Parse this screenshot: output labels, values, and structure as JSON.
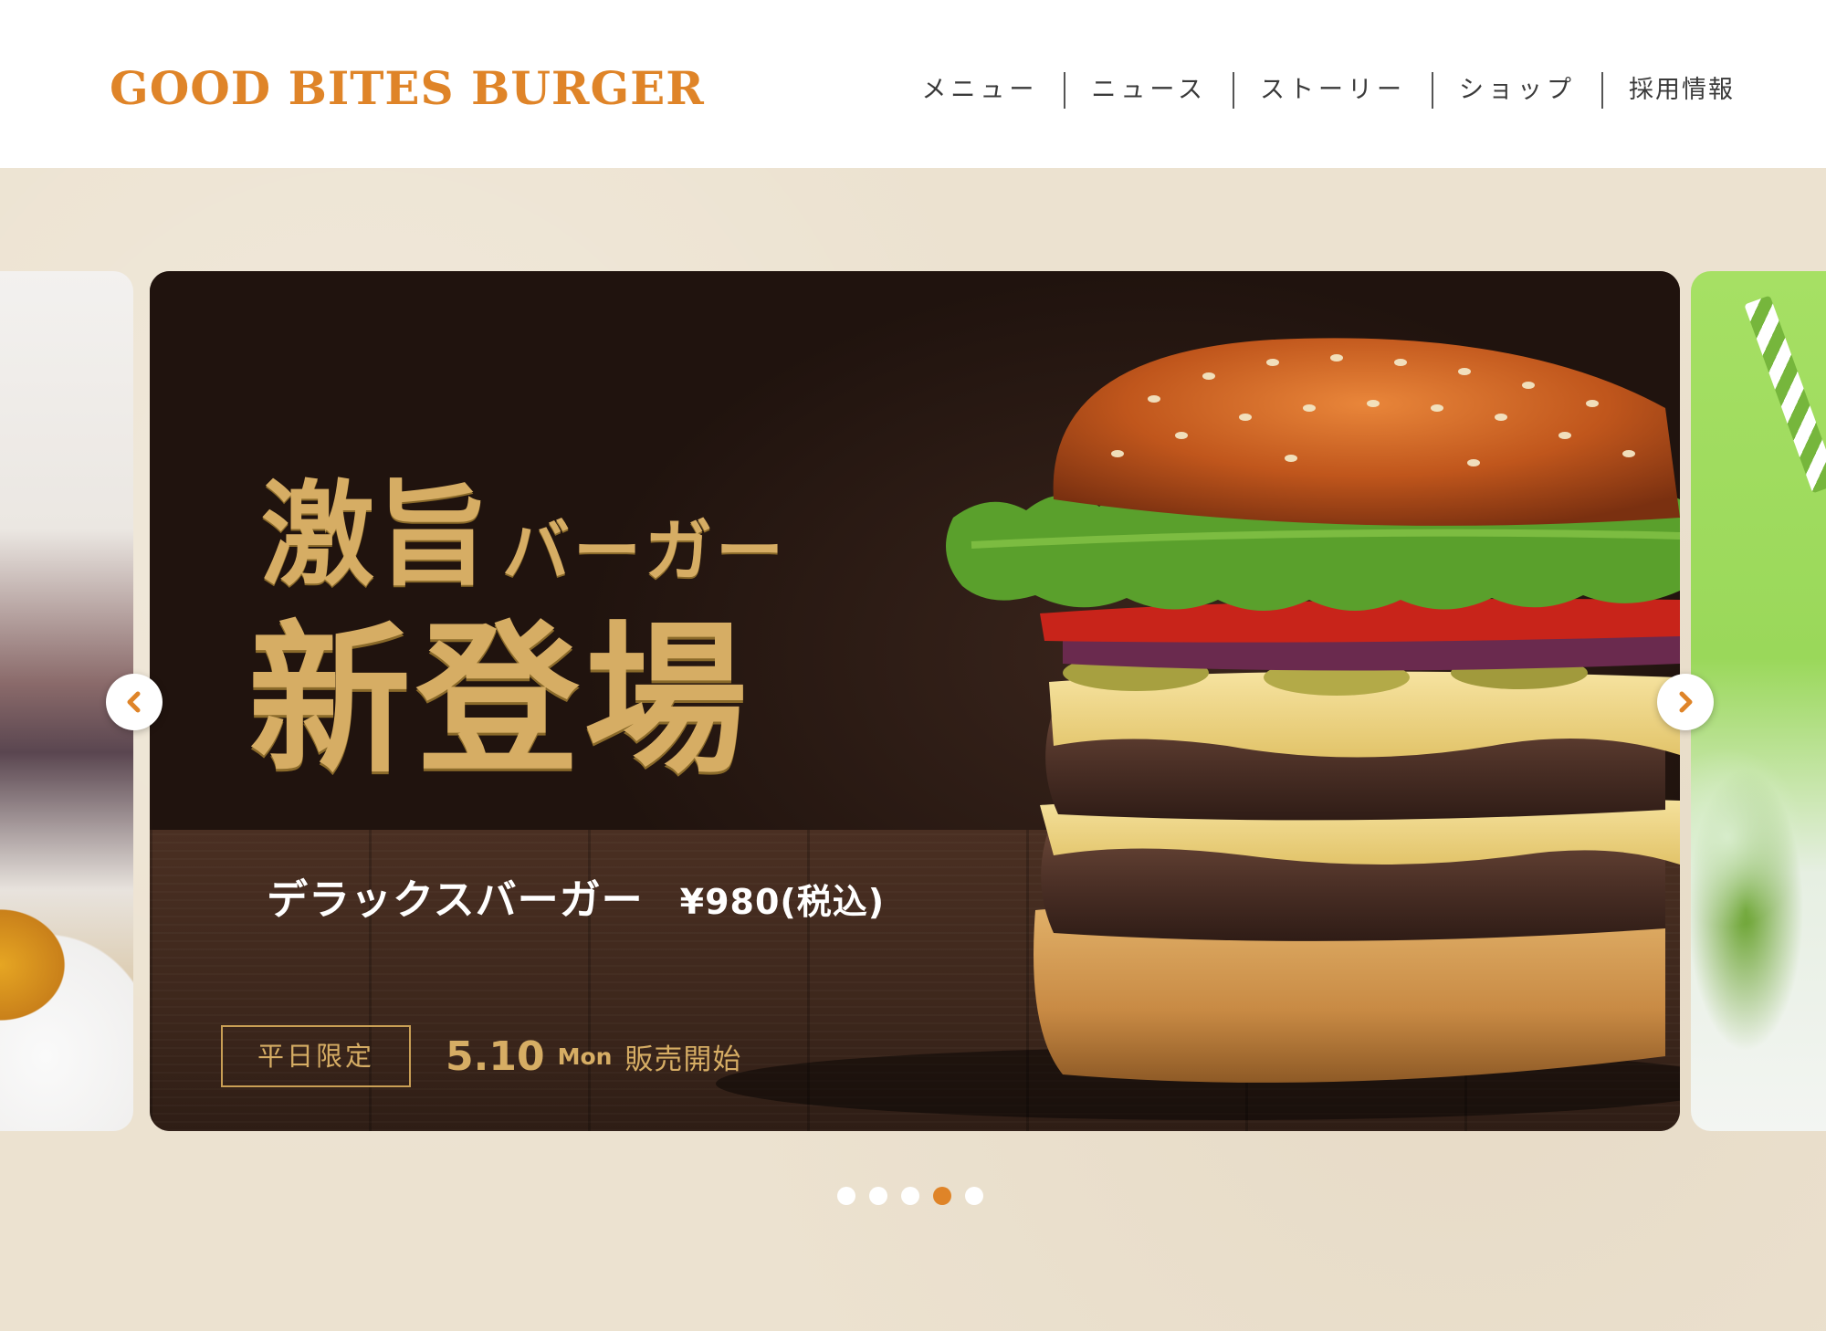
{
  "header": {
    "logo": "GOOD BITES BURGER",
    "nav": [
      {
        "label": "メニュー"
      },
      {
        "label": "ニュース"
      },
      {
        "label": "ストーリー"
      },
      {
        "label": "ショップ"
      },
      {
        "label": "採用情報"
      }
    ]
  },
  "slide": {
    "headline_big": "激旨",
    "headline_small": "バーガー",
    "headline_main": "新登場",
    "product_name": "デラックスバーガー",
    "price": "¥980(税込)",
    "tag": "平日限定",
    "release_date": "5.10",
    "release_day": "Mon",
    "release_text": "販売開始"
  },
  "carousel": {
    "prev_icon": "chevron-left-icon",
    "next_icon": "chevron-right-icon",
    "slide_count": 5,
    "active_index": 4
  },
  "colors": {
    "brand": "#df8428",
    "gold": "#d6ad64",
    "background": "#ece2d0"
  }
}
